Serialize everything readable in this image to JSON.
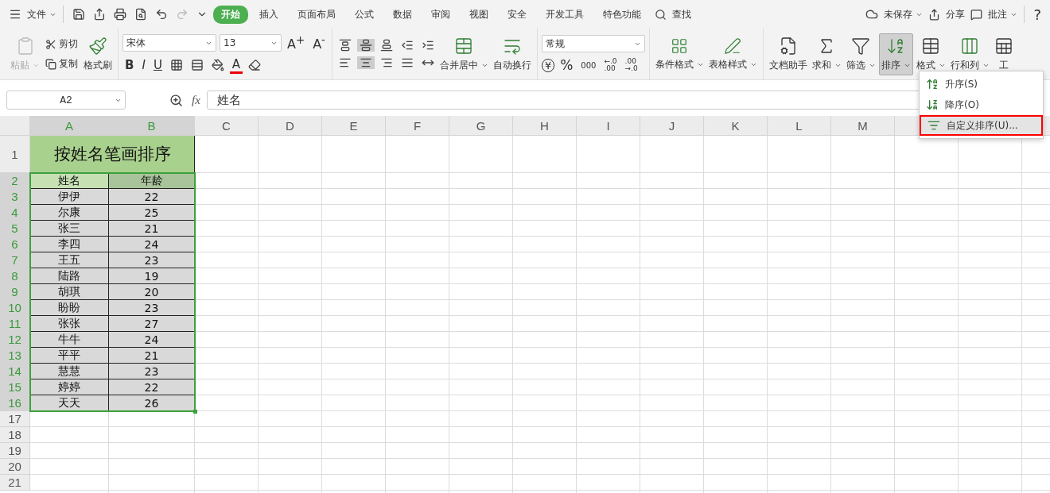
{
  "menu_bar": {
    "file": "文件",
    "tabs": [
      {
        "label": "开始",
        "selected": true
      },
      {
        "label": "插入",
        "selected": false
      },
      {
        "label": "页面布局",
        "selected": false
      },
      {
        "label": "公式",
        "selected": false
      },
      {
        "label": "数据",
        "selected": false
      },
      {
        "label": "审阅",
        "selected": false
      },
      {
        "label": "视图",
        "selected": false
      },
      {
        "label": "安全",
        "selected": false
      },
      {
        "label": "开发工具",
        "selected": false
      },
      {
        "label": "特色功能",
        "selected": false
      }
    ],
    "search": "查找",
    "save_status": "未保存",
    "share": "分享",
    "comment": "批注",
    "help": "?"
  },
  "ribbon": {
    "paste": {
      "label": "粘贴",
      "disabled": true
    },
    "cut": "剪切",
    "copy": "复制",
    "format_painter": "格式刷",
    "font_name": "宋体",
    "font_size": "13",
    "grow_font": "A$^{+}$",
    "shrink_font": "A$^{-}$",
    "bold": "B",
    "italic": "I",
    "underline": "U",
    "font_color": "A",
    "merge": "合并居中",
    "wrap": "自动换行",
    "number_format": "常规",
    "currency": "¥",
    "percent": "%",
    "thousands": "000",
    "increase_decimal": {
      "top": "←.0",
      "bottom": ".00"
    },
    "decrease_decimal": {
      "top": ".00",
      "bottom": "→.0"
    },
    "styles": [
      {
        "label": "条件格式",
        "kind": "conditional"
      },
      {
        "label": "表格样式",
        "kind": "table"
      }
    ],
    "tools": [
      {
        "label": "文档助手",
        "kind": "assistant",
        "dropdown": false,
        "active": false
      },
      {
        "label": "求和",
        "kind": "sum",
        "dropdown": true,
        "active": false
      },
      {
        "label": "筛选",
        "kind": "filter",
        "dropdown": true,
        "active": false
      },
      {
        "label": "排序",
        "kind": "sort",
        "dropdown": true,
        "active": true
      },
      {
        "label": "格式",
        "kind": "format",
        "dropdown": true,
        "active": false
      },
      {
        "label": "行和列",
        "kind": "rows",
        "dropdown": true,
        "active": false
      },
      {
        "label": "工",
        "kind": "sheet",
        "dropdown": false,
        "active": false
      }
    ]
  },
  "formula_bar": {
    "name_box": "A2",
    "fx": "fx",
    "value": "姓名"
  },
  "sheet": {
    "columns": [
      {
        "label": "A",
        "selected": true
      },
      {
        "label": "B",
        "selected": true
      },
      {
        "label": "C",
        "selected": false
      },
      {
        "label": "D",
        "selected": false
      },
      {
        "label": "E",
        "selected": false
      },
      {
        "label": "F",
        "selected": false
      },
      {
        "label": "G",
        "selected": false
      },
      {
        "label": "H",
        "selected": false
      },
      {
        "label": "I",
        "selected": false
      },
      {
        "label": "J",
        "selected": false
      },
      {
        "label": "K",
        "selected": false
      },
      {
        "label": "L",
        "selected": false
      },
      {
        "label": "M",
        "selected": false
      }
    ],
    "title": {
      "row": "1",
      "text": "按姓名笔画排序"
    },
    "rows": [
      {
        "number": "2",
        "selected": true,
        "kind": "header",
        "cells": [
          "姓名",
          "年龄"
        ]
      },
      {
        "number": "3",
        "selected": true,
        "kind": "data",
        "cells": [
          "伊伊",
          "22"
        ]
      },
      {
        "number": "4",
        "selected": true,
        "kind": "data",
        "cells": [
          "尔康",
          "25"
        ]
      },
      {
        "number": "5",
        "selected": true,
        "kind": "data",
        "cells": [
          "张三",
          "21"
        ]
      },
      {
        "number": "6",
        "selected": true,
        "kind": "data",
        "cells": [
          "李四",
          "24"
        ]
      },
      {
        "number": "7",
        "selected": true,
        "kind": "data",
        "cells": [
          "王五",
          "23"
        ]
      },
      {
        "number": "8",
        "selected": true,
        "kind": "data",
        "cells": [
          "陆路",
          "19"
        ]
      },
      {
        "number": "9",
        "selected": true,
        "kind": "data",
        "cells": [
          "胡琪",
          "20"
        ]
      },
      {
        "number": "10",
        "selected": true,
        "kind": "data",
        "cells": [
          "盼盼",
          "23"
        ]
      },
      {
        "number": "11",
        "selected": true,
        "kind": "data",
        "cells": [
          "张张",
          "27"
        ]
      },
      {
        "number": "12",
        "selected": true,
        "kind": "data",
        "cells": [
          "牛牛",
          "24"
        ]
      },
      {
        "number": "13",
        "selected": true,
        "kind": "data",
        "cells": [
          "平平",
          "21"
        ]
      },
      {
        "number": "14",
        "selected": true,
        "kind": "data",
        "cells": [
          "慧慧",
          "23"
        ]
      },
      {
        "number": "15",
        "selected": true,
        "kind": "data",
        "cells": [
          "婷婷",
          "22"
        ]
      },
      {
        "number": "16",
        "selected": true,
        "kind": "data",
        "cells": [
          "天天",
          "26"
        ]
      },
      {
        "number": "17",
        "selected": false,
        "kind": "empty",
        "cells": []
      },
      {
        "number": "18",
        "selected": false,
        "kind": "empty",
        "cells": []
      },
      {
        "number": "19",
        "selected": false,
        "kind": "empty",
        "cells": []
      },
      {
        "number": "20",
        "selected": false,
        "kind": "empty",
        "cells": []
      },
      {
        "number": "21",
        "selected": false,
        "kind": "empty",
        "cells": []
      }
    ]
  },
  "sort_menu": {
    "items": [
      {
        "label": "升序(S)",
        "kind": "ascending",
        "highlighted": false
      },
      {
        "label": "降序(O)",
        "kind": "descending",
        "highlighted": false
      },
      {
        "label": "自定义排序(U)...",
        "kind": "custom",
        "highlighted": true
      }
    ]
  }
}
